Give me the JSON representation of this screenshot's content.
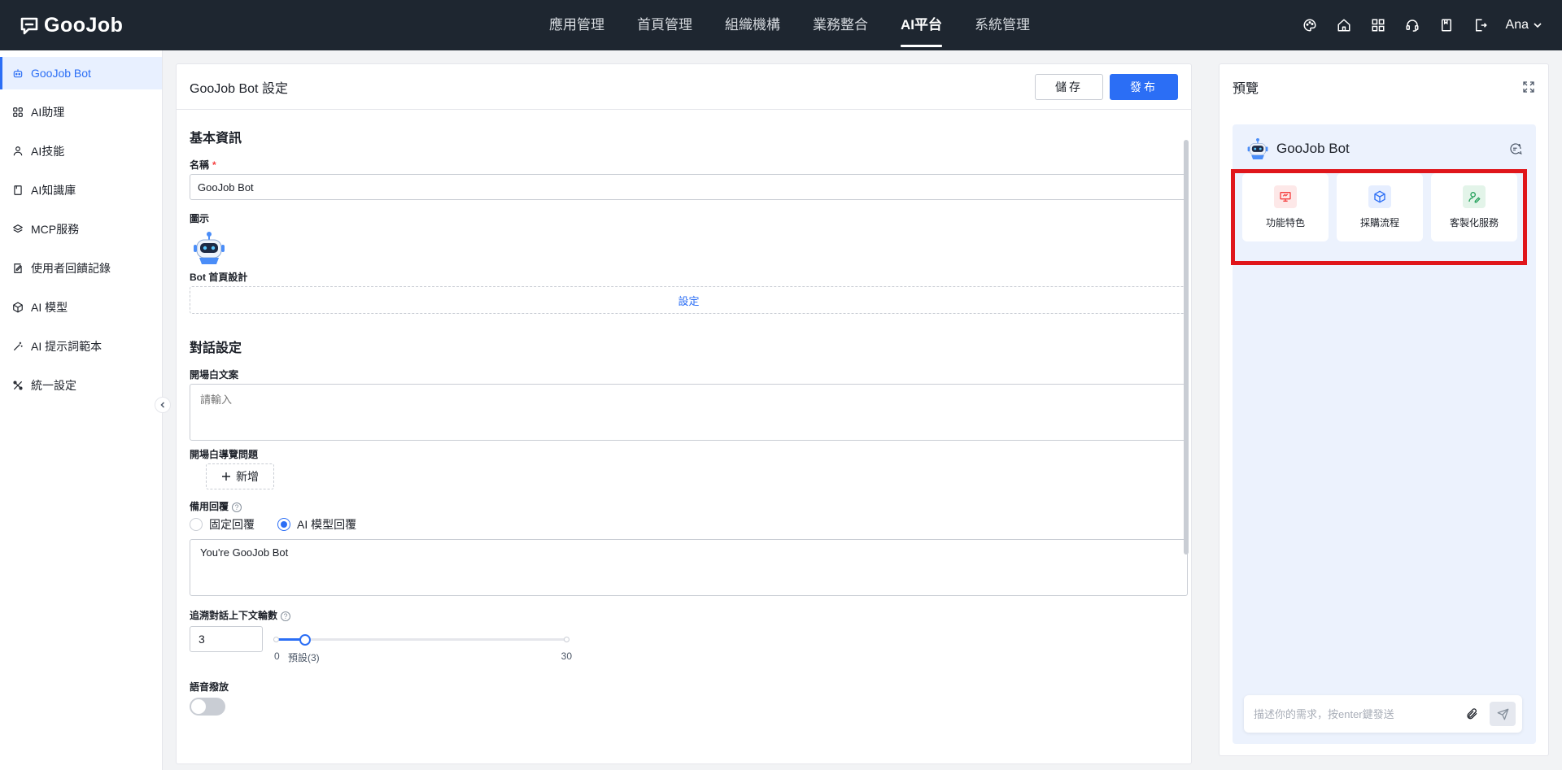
{
  "app": {
    "logo": "GooJob"
  },
  "nav": [
    "應用管理",
    "首頁管理",
    "組織機構",
    "業務整合",
    "AI平台",
    "系統管理"
  ],
  "nav_active": "AI平台",
  "user": {
    "name": "Ana"
  },
  "top_icons": [
    "theme-icon",
    "home-icon",
    "apps-icon",
    "support-icon",
    "document-icon",
    "export-icon"
  ],
  "sidebar": {
    "items": [
      {
        "label": "GooJob Bot",
        "icon": "robot-icon"
      },
      {
        "label": "AI助理",
        "icon": "grid-icon"
      },
      {
        "label": "AI技能",
        "icon": "skill-icon"
      },
      {
        "label": "AI知識庫",
        "icon": "book-icon"
      },
      {
        "label": "MCP服務",
        "icon": "layers-icon"
      },
      {
        "label": "使用者回饋記錄",
        "icon": "feedback-icon"
      },
      {
        "label": "AI 模型",
        "icon": "cube-icon"
      },
      {
        "label": "AI 提示詞範本",
        "icon": "magic-wand-icon"
      },
      {
        "label": "統一設定",
        "icon": "tools-icon"
      }
    ],
    "active": "GooJob Bot"
  },
  "panel": {
    "title": "GooJob Bot 設定",
    "save_label": "儲存",
    "publish_label": "發布",
    "basic": {
      "title": "基本資訊",
      "name_label": "名稱",
      "name_value": "GooJob Bot",
      "icon_label": "圖示",
      "home_label": "Bot 首頁設計",
      "home_button": "設定"
    },
    "dialog": {
      "title": "對話設定",
      "opening_label": "開場白文案",
      "opening_placeholder": "請輸入",
      "guide_label": "開場白導覽問題",
      "add_label": "新增",
      "fallback_label": "備用回覆",
      "radio_fixed": "固定回覆",
      "radio_ai": "AI 模型回覆",
      "radio_selected": "AI 模型回覆",
      "fallback_value": "You're GooJob Bot",
      "context_label": "追溯對話上下文輪數",
      "context_value": "3",
      "slider": {
        "min": 0,
        "max": 30,
        "value": 3,
        "min_label": "0",
        "default_label": "預設(3)",
        "max_label": "30"
      },
      "voice_label": "語音撥放",
      "voice_on": false
    }
  },
  "preview": {
    "title": "預覽",
    "bot_name": "GooJob Bot",
    "cards": [
      {
        "label": "功能特色",
        "icon": "presentation-icon",
        "color": "#f53f3f",
        "bg": "#fde8e8"
      },
      {
        "label": "採購流程",
        "icon": "box-icon",
        "color": "#2b6ef5",
        "bg": "#e6eeff"
      },
      {
        "label": "客製化服務",
        "icon": "user-edit-icon",
        "color": "#23a05a",
        "bg": "#e3f4e9"
      }
    ],
    "chat_placeholder": "描述你的需求，按enter鍵發送"
  },
  "colors": {
    "accent": "#2b6ef5",
    "topbar": "#1e2630",
    "highlight": "#e0161b"
  }
}
